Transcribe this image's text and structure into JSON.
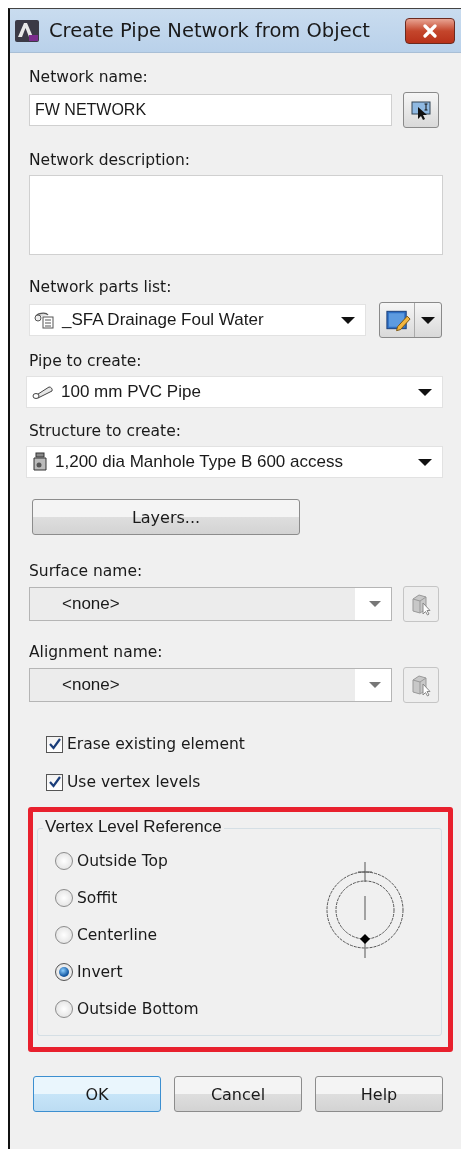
{
  "window": {
    "title": "Create Pipe Network from Object"
  },
  "network_name": {
    "label": "Network name:",
    "value": "FW NETWORK"
  },
  "network_description": {
    "label": "Network description:"
  },
  "parts_list": {
    "label": "Network parts list:",
    "value": "_SFA Drainage Foul Water"
  },
  "pipe": {
    "label": "Pipe to create:",
    "value": "100 mm PVC Pipe"
  },
  "structure": {
    "label": "Structure to create:",
    "value": "1,200 dia Manhole Type B 600 access"
  },
  "layers_button": "Layers...",
  "surface": {
    "label": "Surface name:",
    "value": "<none>",
    "disabled": true
  },
  "alignment": {
    "label": "Alignment name:",
    "value": "<none>",
    "disabled": true
  },
  "checkboxes": [
    {
      "label": "Erase existing element",
      "checked": true
    },
    {
      "label": "Use vertex levels",
      "checked": true
    }
  ],
  "vertex_level_reference": {
    "title": "Vertex Level Reference",
    "options": [
      {
        "label": "Outside Top",
        "selected": false
      },
      {
        "label": "Soffit",
        "selected": false
      },
      {
        "label": "Centerline",
        "selected": false
      },
      {
        "label": "Invert",
        "selected": true
      },
      {
        "label": "Outside Bottom",
        "selected": false
      }
    ]
  },
  "buttons": [
    {
      "label": "OK",
      "default": true
    },
    {
      "label": "Cancel",
      "default": false
    },
    {
      "label": "Help",
      "default": false
    }
  ]
}
